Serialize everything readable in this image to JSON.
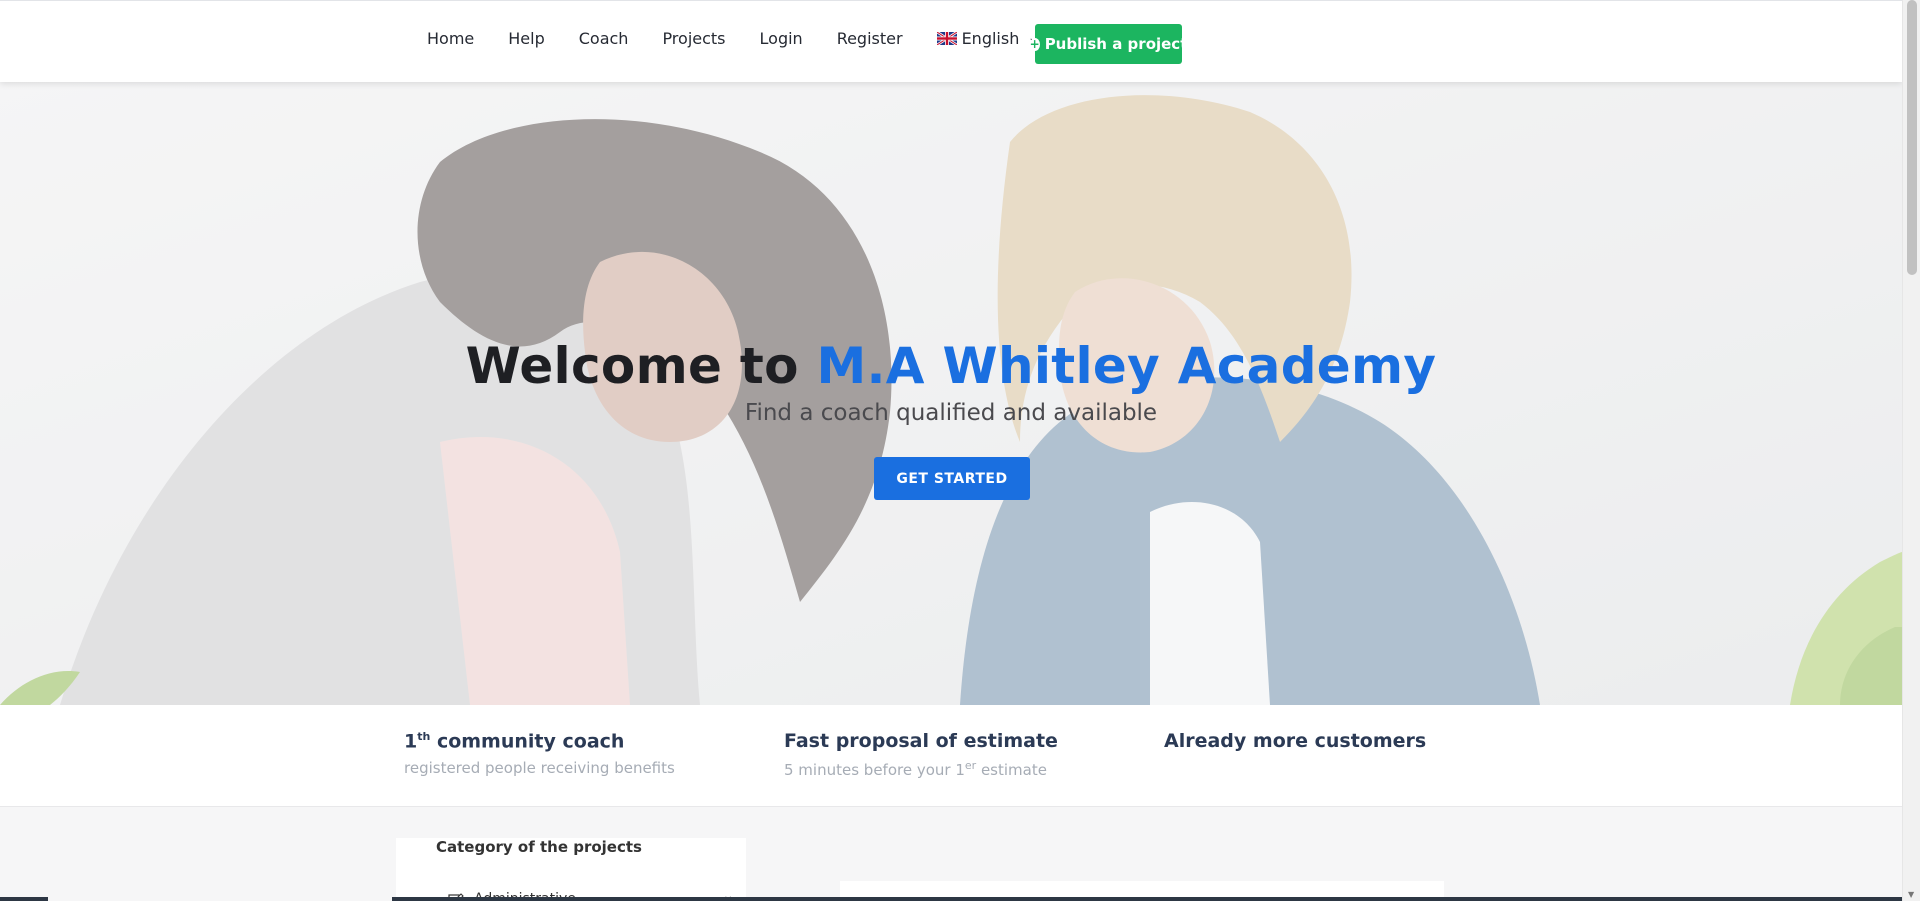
{
  "nav": {
    "items": [
      {
        "label": "Home"
      },
      {
        "label": "Help"
      },
      {
        "label": "Coach"
      },
      {
        "label": "Projects"
      },
      {
        "label": "Login"
      },
      {
        "label": "Register"
      }
    ],
    "language": "English",
    "publish_label": "Publish a project"
  },
  "hero": {
    "title_prefix": "Welcome to",
    "title_accent": "M.A Whitley Academy",
    "subtitle": "Find a coach qualified and available",
    "cta_label": "GET STARTED"
  },
  "features": [
    {
      "title_num": "1",
      "title_sup": "th",
      "title_rest": " community coach",
      "desc_main": "registered people receiving benefits",
      "desc_sup": "",
      "desc_rest": ""
    },
    {
      "title_num": "",
      "title_sup": "",
      "title_rest": "Fast proposal of estimate",
      "desc_main": "5 minutes before your 1",
      "desc_sup": "er",
      "desc_rest": " estimate"
    },
    {
      "title_num": "",
      "title_sup": "",
      "title_rest": "Already more customers",
      "desc_main": "",
      "desc_sup": "",
      "desc_rest": ""
    }
  ],
  "categories": {
    "title": "Category of the projects",
    "first_item": "Administrative"
  },
  "colors": {
    "accent_blue": "#1a6fe0",
    "publish_green": "#1cb560",
    "heading_navy": "#2b3a55"
  },
  "icons": [
    "flag-uk-icon",
    "chevron-down-icon",
    "plus-circle-icon",
    "edit-icon"
  ]
}
